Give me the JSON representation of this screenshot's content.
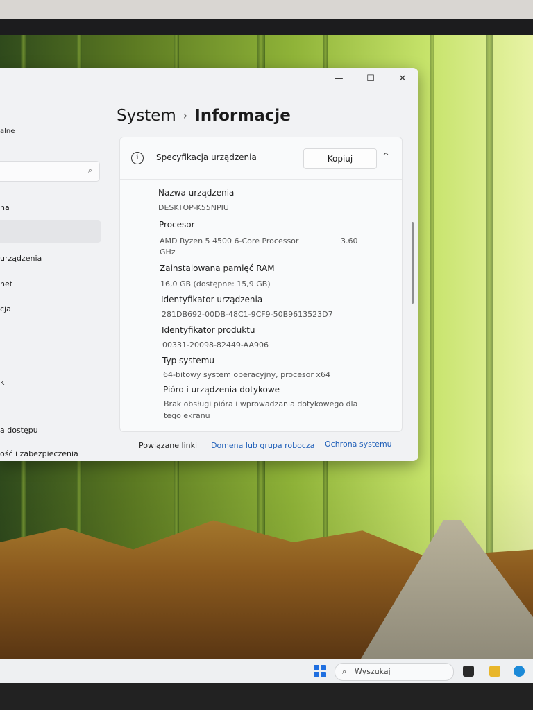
{
  "window": {
    "title": "Informacje",
    "controls": {
      "minimize": "—",
      "maximize": "☐",
      "close": "✕"
    }
  },
  "sidebar": {
    "partial_items": [
      "alne",
      "na",
      "urządzenia",
      "net",
      "cja",
      "k",
      "a dostępu",
      "ość i zabezpieczenia"
    ]
  },
  "breadcrumb": {
    "parent": "System",
    "separator": "›",
    "current": "Informacje"
  },
  "spec_section": {
    "title": "Specyfikacja urządzenia",
    "copy_label": "Kopiuj",
    "info_icon": "i",
    "collapse_icon": "^",
    "rows": [
      {
        "label": "Nazwa urządzenia",
        "value": "DESKTOP-K55NPIU"
      },
      {
        "label": "Procesor",
        "value": "AMD Ryzen 5 4500 6-Core Processor",
        "value_extra": "3.60",
        "value_line2": "GHz"
      },
      {
        "label": "Zainstalowana pamięć RAM",
        "value": "16,0 GB (dostępne: 15,9 GB)"
      },
      {
        "label": "Identyfikator urządzenia",
        "value": "281DB692-00DB-48C1-9CF9-50B9613523D7"
      },
      {
        "label": "Identyfikator produktu",
        "value": "00331-20098-82449-AA906"
      },
      {
        "label": "Typ systemu",
        "value": "64-bitowy system operacyjny, procesor x64"
      },
      {
        "label": "Pióro i urządzenia dotykowe",
        "value": "Brak obsługi pióra i wprowadzania dotykowego dla",
        "value_line2": "tego ekranu"
      }
    ]
  },
  "related_links": {
    "label": "Powiązane linki",
    "links": [
      "Domena lub grupa robocza",
      "Ochrona systemu"
    ]
  },
  "taskbar": {
    "search_placeholder": "Wyszukaj"
  },
  "colors": {
    "accent": "#1f5fb8",
    "start": "#1f6fe0"
  }
}
